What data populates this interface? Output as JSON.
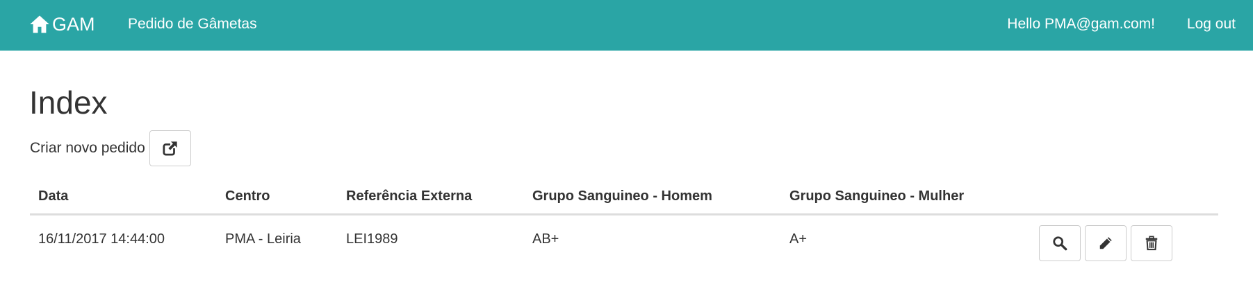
{
  "navbar": {
    "brand": "GAM",
    "brand_icon": "home-icon",
    "link_gametas": "Pedido de Gâmetas",
    "greeting": "Hello PMA@gam.com!",
    "logout": "Log out",
    "background_color": "#2aa5a5"
  },
  "page": {
    "title": "Index",
    "create_label": "Criar novo pedido",
    "create_icon": "external-link-icon"
  },
  "table": {
    "headers": [
      "Data",
      "Centro",
      "Referência Externa",
      "Grupo Sanguineo - Homem",
      "Grupo Sanguineo - Mulher"
    ],
    "rows": [
      {
        "data": "16/11/2017 14:44:00",
        "centro": "PMA - Leiria",
        "referencia": "LEI1989",
        "grupo_homem": "AB+",
        "grupo_mulher": "A+",
        "actions": [
          "search-icon",
          "pencil-icon",
          "trash-icon"
        ]
      }
    ]
  }
}
